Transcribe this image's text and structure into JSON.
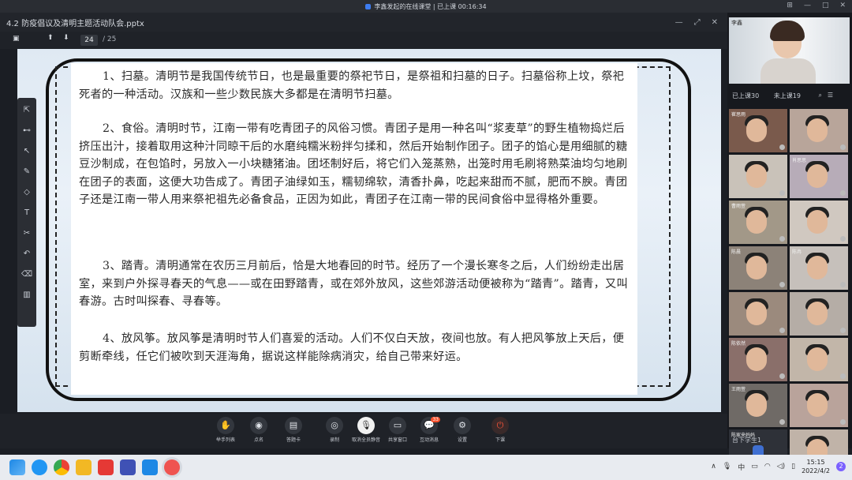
{
  "session_title": "李鑫发起的在线课堂 | 已上课 00:16:34",
  "document": {
    "title": "4.2 防疫倡议及清明主题活动队会.pptx",
    "current_page": "24",
    "total_pages": "/ 25"
  },
  "slide": {
    "paragraphs": [
      "1、扫墓。清明节是我国传统节日，也是最重要的祭祀节日，是祭祖和扫墓的日子。扫墓俗称上坟，祭祀死者的一种活动。汉族和一些少数民族大多都是在清明节扫墓。",
      "2、食俗。清明时节，江南一带有吃青团子的风俗习惯。青团子是用一种名叫“浆麦草”的野生植物捣烂后挤压出汁，接着取用这种汁同晾干后的水磨纯糯米粉拌匀揉和，然后开始制作团子。团子的馅心是用细腻的糖豆沙制成，在包馅时，另放入一小块糖猪油。团坯制好后，将它们入笼蒸熟，出笼时用毛刷将熟菜油均匀地刷在团子的表面，这便大功告成了。青团子油绿如玉，糯韧绵软，清香扑鼻，吃起来甜而不腻，肥而不腴。青团子还是江南一带人用来祭祀祖先必备食品，正因为如此，青团子在江南一带的民间食俗中显得格外重要。",
      "3、踏青。清明通常在农历三月前后，恰是大地春回的时节。经历了一个漫长寒冬之后，人们纷纷走出居室，来到户外探寻春天的气息——或在田野踏青，或在郊外放风，这些郊游活动便被称为“踏青”。踏青，又叫春游。古时叫探春、寻春等。",
      "4、放风筝。放风筝是清明时节人们喜爱的活动。人们不仅白天放，夜间也放。有人把风筝放上天后，便剪断牵线，任它们被吹到天涯海角，据说这样能除病消灾，给自己带来好运。"
    ]
  },
  "bottom_buttons": [
    {
      "label": "举手列表",
      "icon": "✋"
    },
    {
      "label": "点名",
      "icon": "◉"
    },
    {
      "label": "答题卡",
      "icon": "▤"
    },
    {
      "label": "录制",
      "icon": "◎"
    },
    {
      "label": "取消全员静音",
      "icon": "🎙"
    },
    {
      "label": "共享窗口",
      "icon": "▭"
    },
    {
      "label": "互动消息",
      "icon": "💬",
      "badge": "33"
    },
    {
      "label": "设置",
      "icon": "⚙"
    },
    {
      "label": "下课",
      "icon": "⏻"
    }
  ],
  "panel": {
    "teacher_name": "李鑫",
    "tab_joined": "已上课30",
    "tab_not_joined": "未上课19",
    "students": [
      "崔思雨",
      "",
      "",
      "肖思思",
      "曹雨萱",
      "",
      "陈晨",
      "陈冉",
      "",
      "",
      "陈依然",
      "",
      "王雨萱",
      "",
      "陈家来妈妈",
      ""
    ],
    "footer": "台下学生1"
  },
  "taskbar": {
    "ime": "中",
    "time": "15:15",
    "date": "2022/4/2",
    "notif": "2"
  },
  "colors": {
    "accent": "#f5502d",
    "frame": "#111111"
  }
}
